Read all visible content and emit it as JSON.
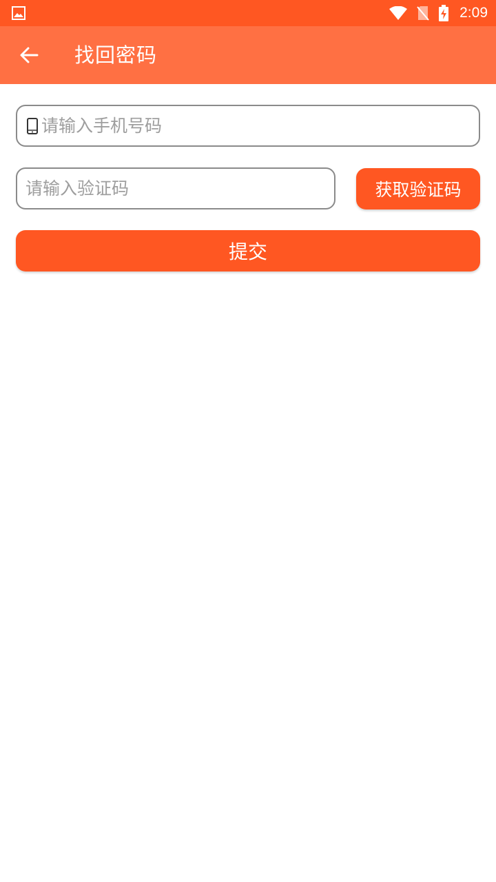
{
  "status_bar": {
    "time": "2:09",
    "icons": [
      "image-notification-icon",
      "wifi-icon",
      "no-sim-icon",
      "battery-charging-icon"
    ]
  },
  "app_bar": {
    "title": "找回密码",
    "back_icon": "arrow-left-icon"
  },
  "form": {
    "phone": {
      "placeholder": "请输入手机号码",
      "value": "",
      "icon": "phone-icon"
    },
    "code": {
      "placeholder": "请输入验证码",
      "value": ""
    },
    "get_code_label": "获取验证码",
    "submit_label": "提交"
  },
  "colors": {
    "status_bar": "#ff5722",
    "app_bar": "#ff7043",
    "accent": "#ff5722",
    "field_border": "#8a8a8a",
    "placeholder": "#9e9e9e"
  }
}
